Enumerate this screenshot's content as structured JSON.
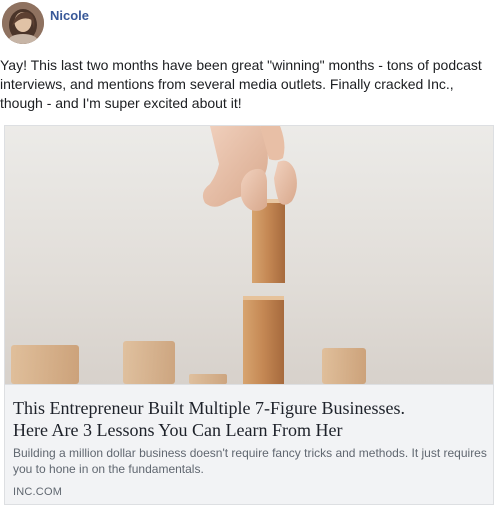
{
  "post": {
    "author": "Nicole",
    "text": "Yay! This last two months have been great \"winning\" months - tons of podcast interviews, and mentions from several media outlets. Finally cracked Inc., though - and I'm super excited about it!",
    "link_card": {
      "title_line_1": "This Entrepreneur Built Multiple 7-Figure Businesses.",
      "title_line_2": "Here Are 3 Lessons You Can Learn From Her",
      "description": "Building a million dollar business doesn't require fancy tricks and methods. It just requires you to hone in on the fundamentals.",
      "domain": "INC.COM"
    }
  },
  "icons": {
    "avatar": "profile-photo"
  },
  "colors": {
    "author_link": "#385898",
    "card_meta_bg": "#f2f3f5",
    "text_primary": "#1c1e21",
    "text_secondary": "#606770"
  }
}
